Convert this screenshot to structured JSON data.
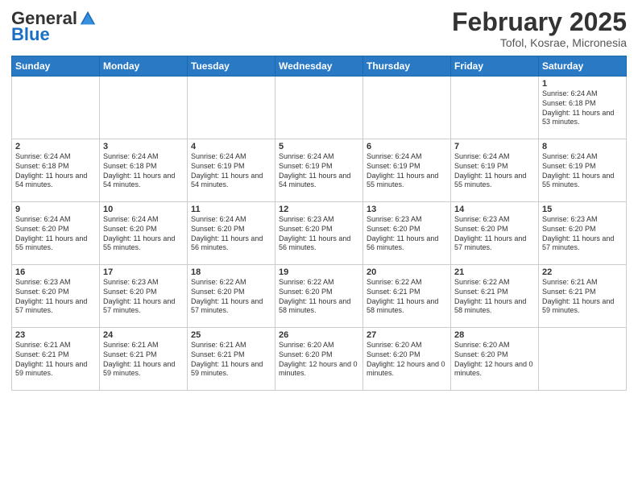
{
  "header": {
    "logo_general": "General",
    "logo_blue": "Blue",
    "month_title": "February 2025",
    "location": "Tofol, Kosrae, Micronesia"
  },
  "days_of_week": [
    "Sunday",
    "Monday",
    "Tuesday",
    "Wednesday",
    "Thursday",
    "Friday",
    "Saturday"
  ],
  "weeks": [
    [
      {
        "day": "",
        "info": ""
      },
      {
        "day": "",
        "info": ""
      },
      {
        "day": "",
        "info": ""
      },
      {
        "day": "",
        "info": ""
      },
      {
        "day": "",
        "info": ""
      },
      {
        "day": "",
        "info": ""
      },
      {
        "day": "1",
        "info": "Sunrise: 6:24 AM\nSunset: 6:18 PM\nDaylight: 11 hours and 53 minutes."
      }
    ],
    [
      {
        "day": "2",
        "info": "Sunrise: 6:24 AM\nSunset: 6:18 PM\nDaylight: 11 hours and 54 minutes."
      },
      {
        "day": "3",
        "info": "Sunrise: 6:24 AM\nSunset: 6:18 PM\nDaylight: 11 hours and 54 minutes."
      },
      {
        "day": "4",
        "info": "Sunrise: 6:24 AM\nSunset: 6:19 PM\nDaylight: 11 hours and 54 minutes."
      },
      {
        "day": "5",
        "info": "Sunrise: 6:24 AM\nSunset: 6:19 PM\nDaylight: 11 hours and 54 minutes."
      },
      {
        "day": "6",
        "info": "Sunrise: 6:24 AM\nSunset: 6:19 PM\nDaylight: 11 hours and 55 minutes."
      },
      {
        "day": "7",
        "info": "Sunrise: 6:24 AM\nSunset: 6:19 PM\nDaylight: 11 hours and 55 minutes."
      },
      {
        "day": "8",
        "info": "Sunrise: 6:24 AM\nSunset: 6:19 PM\nDaylight: 11 hours and 55 minutes."
      }
    ],
    [
      {
        "day": "9",
        "info": "Sunrise: 6:24 AM\nSunset: 6:20 PM\nDaylight: 11 hours and 55 minutes."
      },
      {
        "day": "10",
        "info": "Sunrise: 6:24 AM\nSunset: 6:20 PM\nDaylight: 11 hours and 55 minutes."
      },
      {
        "day": "11",
        "info": "Sunrise: 6:24 AM\nSunset: 6:20 PM\nDaylight: 11 hours and 56 minutes."
      },
      {
        "day": "12",
        "info": "Sunrise: 6:23 AM\nSunset: 6:20 PM\nDaylight: 11 hours and 56 minutes."
      },
      {
        "day": "13",
        "info": "Sunrise: 6:23 AM\nSunset: 6:20 PM\nDaylight: 11 hours and 56 minutes."
      },
      {
        "day": "14",
        "info": "Sunrise: 6:23 AM\nSunset: 6:20 PM\nDaylight: 11 hours and 57 minutes."
      },
      {
        "day": "15",
        "info": "Sunrise: 6:23 AM\nSunset: 6:20 PM\nDaylight: 11 hours and 57 minutes."
      }
    ],
    [
      {
        "day": "16",
        "info": "Sunrise: 6:23 AM\nSunset: 6:20 PM\nDaylight: 11 hours and 57 minutes."
      },
      {
        "day": "17",
        "info": "Sunrise: 6:23 AM\nSunset: 6:20 PM\nDaylight: 11 hours and 57 minutes."
      },
      {
        "day": "18",
        "info": "Sunrise: 6:22 AM\nSunset: 6:20 PM\nDaylight: 11 hours and 57 minutes."
      },
      {
        "day": "19",
        "info": "Sunrise: 6:22 AM\nSunset: 6:20 PM\nDaylight: 11 hours and 58 minutes."
      },
      {
        "day": "20",
        "info": "Sunrise: 6:22 AM\nSunset: 6:21 PM\nDaylight: 11 hours and 58 minutes."
      },
      {
        "day": "21",
        "info": "Sunrise: 6:22 AM\nSunset: 6:21 PM\nDaylight: 11 hours and 58 minutes."
      },
      {
        "day": "22",
        "info": "Sunrise: 6:21 AM\nSunset: 6:21 PM\nDaylight: 11 hours and 59 minutes."
      }
    ],
    [
      {
        "day": "23",
        "info": "Sunrise: 6:21 AM\nSunset: 6:21 PM\nDaylight: 11 hours and 59 minutes."
      },
      {
        "day": "24",
        "info": "Sunrise: 6:21 AM\nSunset: 6:21 PM\nDaylight: 11 hours and 59 minutes."
      },
      {
        "day": "25",
        "info": "Sunrise: 6:21 AM\nSunset: 6:21 PM\nDaylight: 11 hours and 59 minutes."
      },
      {
        "day": "26",
        "info": "Sunrise: 6:20 AM\nSunset: 6:20 PM\nDaylight: 12 hours and 0 minutes."
      },
      {
        "day": "27",
        "info": "Sunrise: 6:20 AM\nSunset: 6:20 PM\nDaylight: 12 hours and 0 minutes."
      },
      {
        "day": "28",
        "info": "Sunrise: 6:20 AM\nSunset: 6:20 PM\nDaylight: 12 hours and 0 minutes."
      },
      {
        "day": "",
        "info": ""
      }
    ]
  ]
}
